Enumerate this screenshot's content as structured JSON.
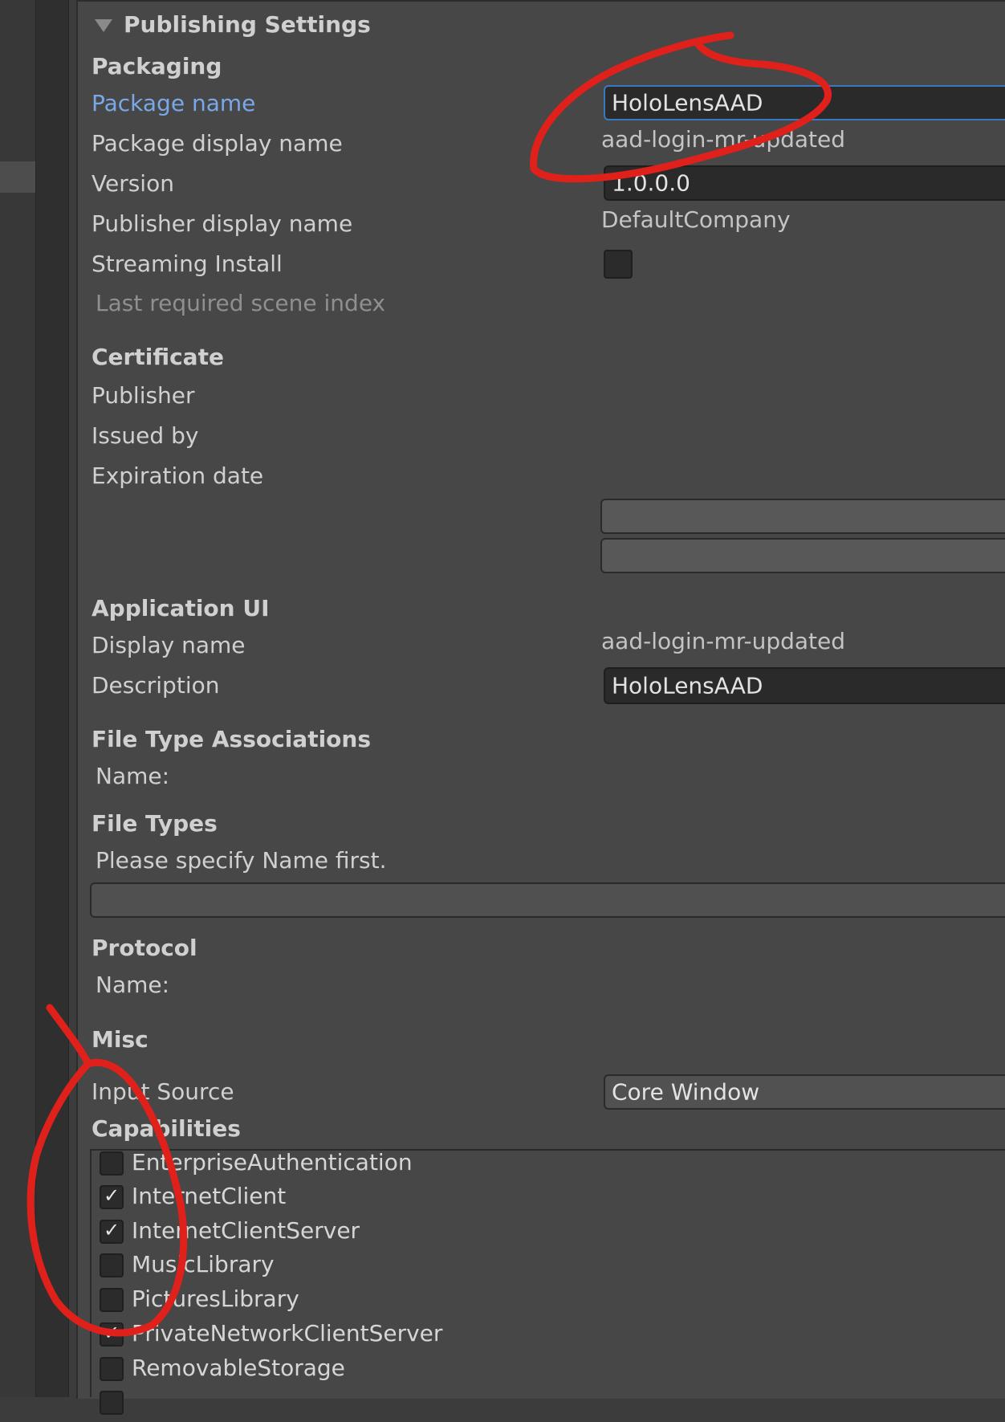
{
  "section_title": "Publishing Settings",
  "packaging": {
    "heading": "Packaging",
    "package_name_label": "Package name",
    "package_name_value": "HoloLensAAD",
    "package_display_name_label": "Package display name",
    "package_display_name_value": "aad-login-mr-updated",
    "version_label": "Version",
    "version_value": "1.0.0.0",
    "publisher_display_name_label": "Publisher display name",
    "publisher_display_name_value": "DefaultCompany",
    "streaming_install_label": "Streaming Install",
    "streaming_install_checked": false,
    "last_scene_index_label": "Last required scene index"
  },
  "certificate": {
    "heading": "Certificate",
    "publisher_label": "Publisher",
    "issued_by_label": "Issued by",
    "expiration_date_label": "Expiration date"
  },
  "application_ui": {
    "heading": "Application UI",
    "display_name_label": "Display name",
    "display_name_value": "aad-login-mr-updated",
    "description_label": "Description",
    "description_value": "HoloLensAAD"
  },
  "file_type_associations": {
    "heading": "File Type Associations",
    "name_label": "Name:"
  },
  "file_types": {
    "heading": "File Types",
    "hint": "Please specify Name first."
  },
  "protocol": {
    "heading": "Protocol",
    "name_label": "Name:"
  },
  "misc": {
    "heading": "Misc",
    "input_source_label": "Input Source",
    "input_source_value": "Core Window"
  },
  "capabilities": {
    "heading": "Capabilities",
    "items": [
      {
        "label": "EnterpriseAuthentication",
        "checked": false
      },
      {
        "label": "InternetClient",
        "checked": true
      },
      {
        "label": "InternetClientServer",
        "checked": true
      },
      {
        "label": "MusicLibrary",
        "checked": false
      },
      {
        "label": "PicturesLibrary",
        "checked": false
      },
      {
        "label": "PrivateNetworkClientServer",
        "checked": true
      },
      {
        "label": "RemovableStorage",
        "checked": false
      }
    ]
  },
  "colors": {
    "panel_bg": "#474747",
    "field_bg": "#2a2a2a",
    "link_label": "#79a8e8",
    "focus_border": "#3b78c2",
    "annotation_red": "#e0211b"
  }
}
